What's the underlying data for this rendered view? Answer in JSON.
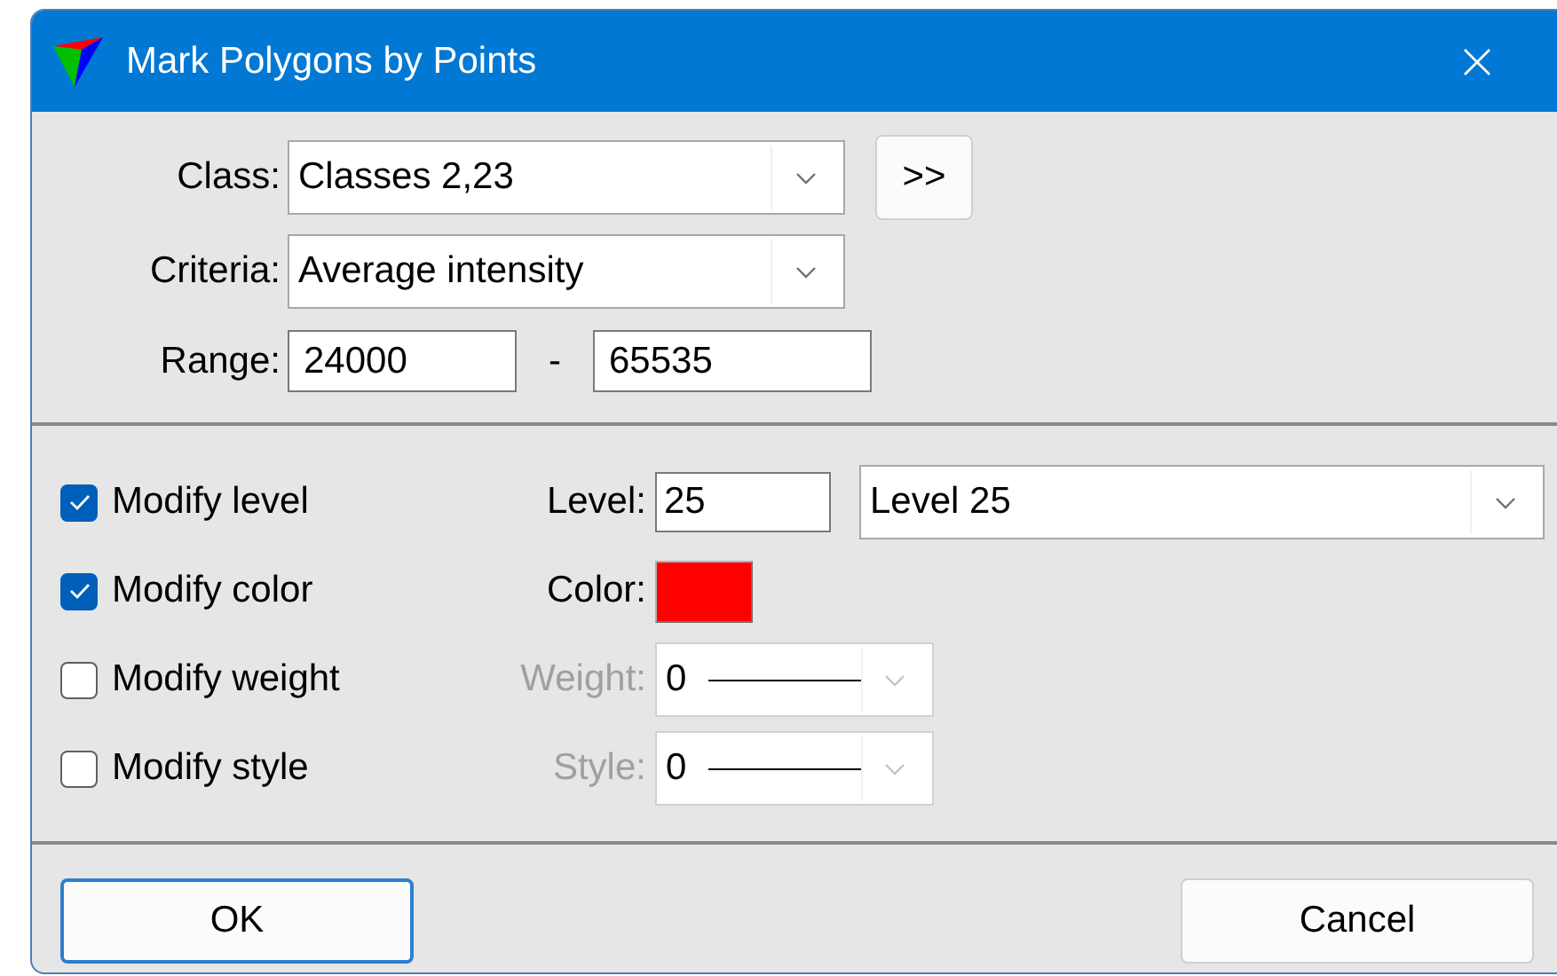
{
  "window": {
    "title": "Mark Polygons by Points"
  },
  "class_field": {
    "label": "Class:",
    "value": "Classes 2,23"
  },
  "more_button": {
    "label": ">>"
  },
  "criteria": {
    "label": "Criteria:",
    "value": "Average intensity"
  },
  "range": {
    "label": "Range:",
    "from": "24000",
    "separator": "-",
    "to": "65535"
  },
  "options": [
    {
      "kind": "level",
      "label": "Modify level",
      "checked": true,
      "disabled": false,
      "field_label": "Level:",
      "value": "25",
      "selection": "Level 25"
    },
    {
      "kind": "color",
      "label": "Modify color",
      "checked": true,
      "disabled": false,
      "field_label": "Color:",
      "color": "#ff0000"
    },
    {
      "kind": "line",
      "label": "Modify weight",
      "checked": false,
      "disabled": true,
      "field_label": "Weight:",
      "value": "0"
    },
    {
      "kind": "line",
      "label": "Modify style",
      "checked": false,
      "disabled": true,
      "field_label": "Style:",
      "value": "0"
    }
  ],
  "buttons": [
    {
      "label": "OK",
      "default": true
    },
    {
      "label": "Cancel",
      "default": false
    }
  ]
}
